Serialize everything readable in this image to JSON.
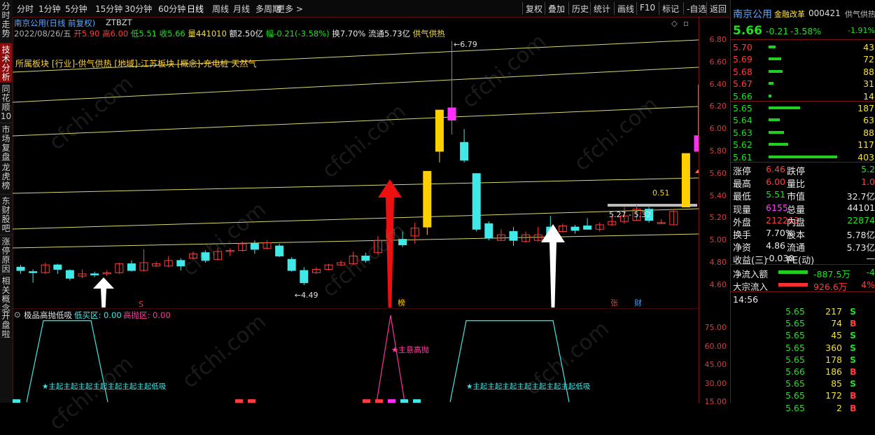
{
  "left_tabs": [
    {
      "label": "分时走势",
      "active": false
    },
    {
      "label": "技术分析",
      "active": true
    },
    {
      "label": "同花顺10",
      "active": false
    },
    {
      "label": "市场复盘",
      "active": false
    },
    {
      "label": "龙虎榜",
      "active": false
    },
    {
      "label": "东财股吧",
      "active": false
    },
    {
      "label": "涨停原因",
      "active": false
    },
    {
      "label": "相关概念",
      "active": false
    },
    {
      "label": "开盘啦",
      "active": false
    }
  ],
  "toolbar": {
    "periods": [
      "分时",
      "1分钟",
      "5分钟",
      "15分钟",
      "30分钟",
      "60分钟",
      "日线",
      "周线",
      "月线",
      "多周期",
      "更多 >"
    ],
    "active_period": "日线",
    "right_buttons": [
      "复权",
      "叠加",
      "历史",
      "统计",
      "画线",
      "F10",
      "标记",
      "-自选",
      "返回"
    ]
  },
  "header": {
    "title": "南京公用(日线 前复权)",
    "formula": "ZTBZT",
    "info_date": "2022/08/26/五",
    "open": "开5.90",
    "high": "高6.00",
    "low": "低5.51",
    "close": "收5.66",
    "volume": "量441010",
    "amount": "额2.50亿",
    "change": "幅-0.21(-3.58%)",
    "turnover": "换7.70%",
    "float": "流通5.73亿",
    "tag": "供气供热",
    "sector": "所属板块 [行业]-供气供热 [地域]-江苏板块 [概念]-充电桩 天然气"
  },
  "chart_annotations": {
    "high_label": "6.79",
    "low_label": "4.49",
    "range_label": "5.27 - 5.32",
    "last_label": "0.51",
    "marker_s": "S",
    "marker_bang": "榜",
    "marker_zhang": "张",
    "marker_cai": "财"
  },
  "indicator": {
    "name": "极品高抛低吸",
    "low_label": "低买区: 0.00",
    "high_label": "高抛区: 0.00",
    "note_high": "★主意高抛",
    "note_low": "★主起主起主起主起主起主起主起低吸"
  },
  "watermark": "cfchi.com",
  "y_axis": [
    "6.80",
    "6.60",
    "6.40",
    "6.20",
    "6.00",
    "5.80",
    "5.60",
    "5.40",
    "5.20",
    "5.00",
    "4.80",
    "4.60"
  ],
  "ind_axis": [
    "75.00",
    "60.00",
    "45.00",
    "30.00",
    "15.00"
  ],
  "stock": {
    "name": "南京公用",
    "concept": "金融改革",
    "code": "000421",
    "sector": "供气供热",
    "price": "5.66",
    "change": "-0.21",
    "pct": "-3.58%",
    "sector_pct": "-1.91%"
  },
  "asks": [
    {
      "price": "5.70",
      "vol": "43",
      "bar": 0.1
    },
    {
      "price": "5.69",
      "vol": "72",
      "bar": 0.18
    },
    {
      "price": "5.68",
      "vol": "88",
      "bar": 0.2
    },
    {
      "price": "5.67",
      "vol": "31",
      "bar": 0.07
    },
    {
      "price": "5.66",
      "vol": "14",
      "bar": 0.03
    }
  ],
  "bids": [
    {
      "price": "5.65",
      "vol": "187",
      "bar": 0.46
    },
    {
      "price": "5.64",
      "vol": "63",
      "bar": 0.16
    },
    {
      "price": "5.63",
      "vol": "88",
      "bar": 0.22
    },
    {
      "price": "5.62",
      "vol": "117",
      "bar": 0.29
    },
    {
      "price": "5.61",
      "vol": "403",
      "bar": 1.0
    }
  ],
  "stats": [
    [
      {
        "k": "涨停",
        "v": "6.46",
        "c": "red"
      },
      {
        "k": "跌停",
        "v": "5.2",
        "c": "green"
      }
    ],
    [
      {
        "k": "最高",
        "v": "6.00",
        "c": "red"
      },
      {
        "k": "量比",
        "v": "1.0",
        "c": "red"
      }
    ],
    [
      {
        "k": "最低",
        "v": "5.51",
        "c": "green"
      },
      {
        "k": "市值",
        "v": "32.7亿",
        "c": "white"
      }
    ],
    [
      {
        "k": "现量",
        "v": "6155",
        "c": "mag"
      },
      {
        "k": "总量",
        "v": "44101",
        "c": "white"
      }
    ],
    [
      {
        "k": "外盘",
        "v": "212263",
        "c": "red"
      },
      {
        "k": "内盘",
        "v": "22874",
        "c": "green"
      }
    ],
    [
      {
        "k": "换手",
        "v": "7.70%",
        "c": "white"
      },
      {
        "k": "股本",
        "v": "5.78亿",
        "c": "white"
      }
    ],
    [
      {
        "k": "净资",
        "v": "4.86",
        "c": "white"
      },
      {
        "k": "流通",
        "v": "5.73亿",
        "c": "white"
      }
    ],
    [
      {
        "k": "收益(三)",
        "v": "-0.030",
        "c": "white"
      },
      {
        "k": "PE(动)",
        "v": "—",
        "c": "white"
      }
    ]
  ],
  "flows": [
    {
      "k": "净流入额",
      "v": "-887.5万",
      "pct": "-4",
      "c": "green"
    },
    {
      "k": "大宗流入",
      "v": "926.6万",
      "pct": "4%",
      "c": "red"
    }
  ],
  "ticks_time": "14:56",
  "ticks": [
    {
      "p": "5.65",
      "v": "217",
      "d": "S"
    },
    {
      "p": "5.65",
      "v": "74",
      "d": "B"
    },
    {
      "p": "5.65",
      "v": "45",
      "d": "S"
    },
    {
      "p": "5.65",
      "v": "360",
      "d": "S"
    },
    {
      "p": "5.65",
      "v": "178",
      "d": "S"
    },
    {
      "p": "5.66",
      "v": "186",
      "d": "B"
    },
    {
      "p": "5.65",
      "v": "85",
      "d": "S"
    },
    {
      "p": "5.65",
      "v": "172",
      "d": "B"
    },
    {
      "p": "5.65",
      "v": "2",
      "d": "B"
    }
  ],
  "colors": {
    "up": "#ff3c3c",
    "down": "#40e8e8",
    "limit_up": "#ffd000",
    "limit_break": "#ff30ff",
    "arrow_red": "#ee1010",
    "arrow_white": "#ffffff",
    "line": "#d8d870"
  }
}
